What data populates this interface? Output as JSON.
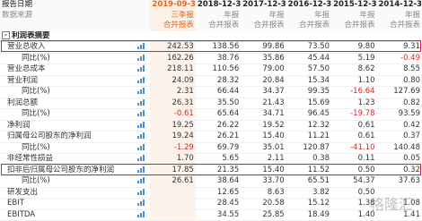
{
  "header": {
    "row1_label": "报告日期",
    "row2_label": "数据来源",
    "dates": [
      "2019-09-30",
      "2018-12-31",
      "2017-12-31",
      "2016-12-31",
      "2015-12-31",
      "2014-12-31"
    ],
    "period_types": [
      "三季报",
      "年报",
      "年报",
      "年报",
      "年报",
      "年报"
    ],
    "sources": [
      "合并报表",
      "合并报表",
      "合并报表",
      "合并报表",
      "合并报表",
      "合并报表"
    ]
  },
  "section": {
    "toggle": "-",
    "label": "利润表摘要"
  },
  "rows": [
    {
      "label": "营业总收入",
      "values": [
        "242.53",
        "138.56",
        "99.86",
        "73.50",
        "9.80",
        "9.31"
      ]
    },
    {
      "label": "同比(%)",
      "values": [
        "162.26",
        "38.76",
        "35.86",
        "45.44",
        "5.19",
        "-0.49"
      ]
    },
    {
      "label": "营业总成本",
      "values": [
        "218.11",
        "110.56",
        "79.00",
        "57.50",
        "8.62",
        "8.55"
      ]
    },
    {
      "label": "营业利润",
      "values": [
        "24.09",
        "28.32",
        "20.84",
        "15.34",
        "1.10",
        "0.80"
      ]
    },
    {
      "label": "同比(%)",
      "values": [
        "2.31",
        "66.44",
        "34.37",
        "99.35",
        "-16.64",
        "127.69"
      ]
    },
    {
      "label": "利润总额",
      "values": [
        "26.31",
        "35.50",
        "21.43",
        "15.69",
        "1.23",
        "0.82"
      ]
    },
    {
      "label": "同比(%)",
      "values": [
        "-0.61",
        "65.64",
        "34.71",
        "96.45",
        "-19.78",
        "93.59"
      ]
    },
    {
      "label": "净利润",
      "values": [
        "19.25",
        "26.22",
        "19.52",
        "12.32",
        "0.61",
        "0.42"
      ]
    },
    {
      "label": "归属母公司股东的净利润",
      "values": [
        "19.24",
        "26.21",
        "15.40",
        "11.21",
        "0.61",
        "0.37"
      ]
    },
    {
      "label": "同比(%)",
      "values": [
        "-1.29",
        "69.79",
        "35.01",
        "120.87",
        "-41.10",
        "140.48"
      ]
    },
    {
      "label": "非经常性损益",
      "values": [
        "1.70",
        "5.65",
        "2.11",
        "0.38",
        "0.11",
        "0.05"
      ]
    },
    {
      "label": "扣非后归属母公司股东的净利润",
      "values": [
        "17.85",
        "21.35",
        "15.40",
        "11.52",
        "0.50",
        "0.32"
      ]
    },
    {
      "label": "同比(%)",
      "values": [
        "26.61",
        "38.64",
        "33.70",
        "65.51",
        "54.37",
        "37.63"
      ]
    },
    {
      "label": "研发支出",
      "values": [
        "",
        "12.65",
        "8.63",
        "3.82",
        "0.50",
        ""
      ]
    },
    {
      "label": "EBIT",
      "values": [
        "",
        "28.45",
        "20.58",
        "15.12",
        "1.38",
        "1.08"
      ]
    },
    {
      "label": "EBITDA",
      "values": [
        "",
        "34.55",
        "25.85",
        "18.49",
        "1.40",
        "1.41"
      ]
    }
  ],
  "watermark": "格隆汇",
  "colors": {
    "accent": "#e8661c",
    "negative": "#e02020",
    "highlight_box": "#e02020",
    "chart_icon": "#4a90d9"
  },
  "icons": {
    "row_chart": "bar-chart-icon",
    "section_toggle": "collapse-icon"
  }
}
